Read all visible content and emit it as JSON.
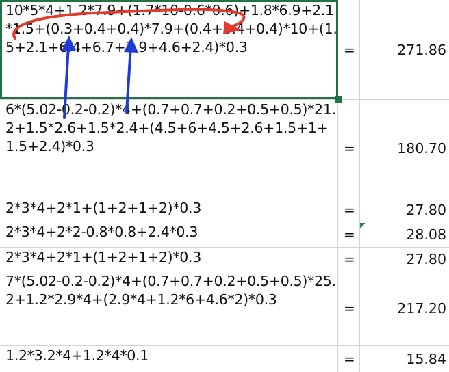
{
  "colors": {
    "selection": "#217346",
    "arrow_red": "#e03b2e",
    "arrow_blue": "#1f3bd6"
  },
  "rows": [
    {
      "formula": "10*5*4+1.2*7.9+(1.7*10-0.6*0.6)+1.8*6.9+2.1*1.5+(0.3+0.4+0.4)*7.9+(0.4+0.4+0.4)*10+(1.5+2.1+6.4+6.7+7.9+4.6+2.4)*0.3",
      "eq": "=",
      "value": "271.86"
    },
    {
      "formula": "6*(5.02-0.2-0.2)*4+(0.7+0.7+0.2+0.5+0.5)*21.2+1.5*2.6+1.5*2.4+(4.5+6+4.5+2.6+1.5+1+1.5+2.4)*0.3",
      "eq": "=",
      "value": "180.70"
    },
    {
      "formula": "2*3*4+2*1+(1+2+1+2)*0.3",
      "eq": "=",
      "value": "27.80"
    },
    {
      "formula": "2*3*4+2*2-0.8*0.8+2.4*0.3",
      "eq": "=",
      "value": "28.08"
    },
    {
      "formula": "2*3*4+2*1+(1+2+1+2)*0.3",
      "eq": "=",
      "value": "27.80"
    },
    {
      "formula": "7*(5.02-0.2-0.2)*4+(0.7+0.7+0.2+0.5+0.5)*25.2+1.2*2.9*4+(2.9*4+1.2*6+4.6*2)*0.3",
      "eq": "=",
      "value": "217.20"
    },
    {
      "formula": "1.2*3.2*4+1.2*4*0.1",
      "eq": "=",
      "value": "15.84"
    }
  ]
}
